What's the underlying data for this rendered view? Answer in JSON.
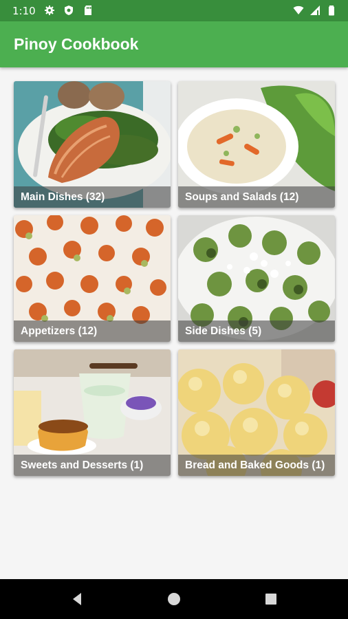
{
  "status_bar": {
    "time": "1:10",
    "icons_left": [
      "gear-icon",
      "shield-icon",
      "sd-card-icon"
    ],
    "icons_right": [
      "wifi-icon",
      "signal-icon",
      "battery-icon"
    ]
  },
  "app_bar": {
    "title": "Pinoy Cookbook",
    "color": "#4caf50",
    "status_color": "#388e3c"
  },
  "categories": [
    {
      "label": "Main Dishes (32)"
    },
    {
      "label": "Soups and Salads (12)"
    },
    {
      "label": "Appetizers (12)"
    },
    {
      "label": "Side Dishes (5)"
    },
    {
      "label": "Sweets and Desserts (1)"
    },
    {
      "label": "Bread and Baked Goods (1)"
    }
  ],
  "nav_bar": {
    "buttons": [
      "back-icon",
      "home-icon",
      "recents-icon"
    ]
  }
}
